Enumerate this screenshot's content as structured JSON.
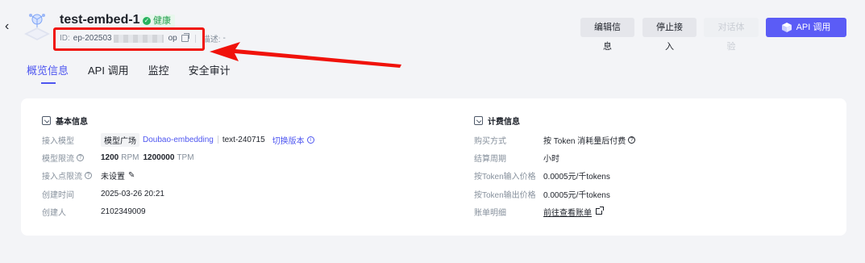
{
  "header": {
    "title": "test-embed-1",
    "status": "健康",
    "id_label": "ID:",
    "id_value": "ep-202503",
    "id_suffix": "op",
    "desc_label": "描述:",
    "desc_value": "-"
  },
  "actions": {
    "edit": "编辑信息",
    "stop": "停止接入",
    "chat": "对话体验",
    "api": "API 调用"
  },
  "tabs": [
    "概览信息",
    "API 调用",
    "监控",
    "安全审计"
  ],
  "basic": {
    "title": "基本信息",
    "model_label": "接入模型",
    "model_tag": "模型广场",
    "model_name": "Doubao-embedding",
    "model_version": "text-240715",
    "switch_version": "切换版本",
    "limit_label": "模型限流",
    "rpm_value": "1200",
    "rpm_unit": "RPM",
    "tpm_value": "1200000",
    "tpm_unit": "TPM",
    "endpoint_limit_label": "接入点限流",
    "endpoint_limit_value": "未设置",
    "created_time_label": "创建时间",
    "created_time_value": "2025-03-26 20:21",
    "creator_label": "创建人",
    "creator_value": "2102349009"
  },
  "billing": {
    "title": "计费信息",
    "purchase_label": "购买方式",
    "purchase_value": "按 Token 消耗量后付费",
    "cycle_label": "结算周期",
    "cycle_value": "小时",
    "input_price_label": "按Token输入价格",
    "input_price_value": "0.0005元/千tokens",
    "output_price_label": "按Token输出价格",
    "output_price_value": "0.0005元/千tokens",
    "bill_label": "账单明细",
    "bill_link": "前往查看账单"
  },
  "colors": {
    "accent": "#5b5cf6",
    "highlight": "#f0120b",
    "healthy": "#27b25e"
  }
}
